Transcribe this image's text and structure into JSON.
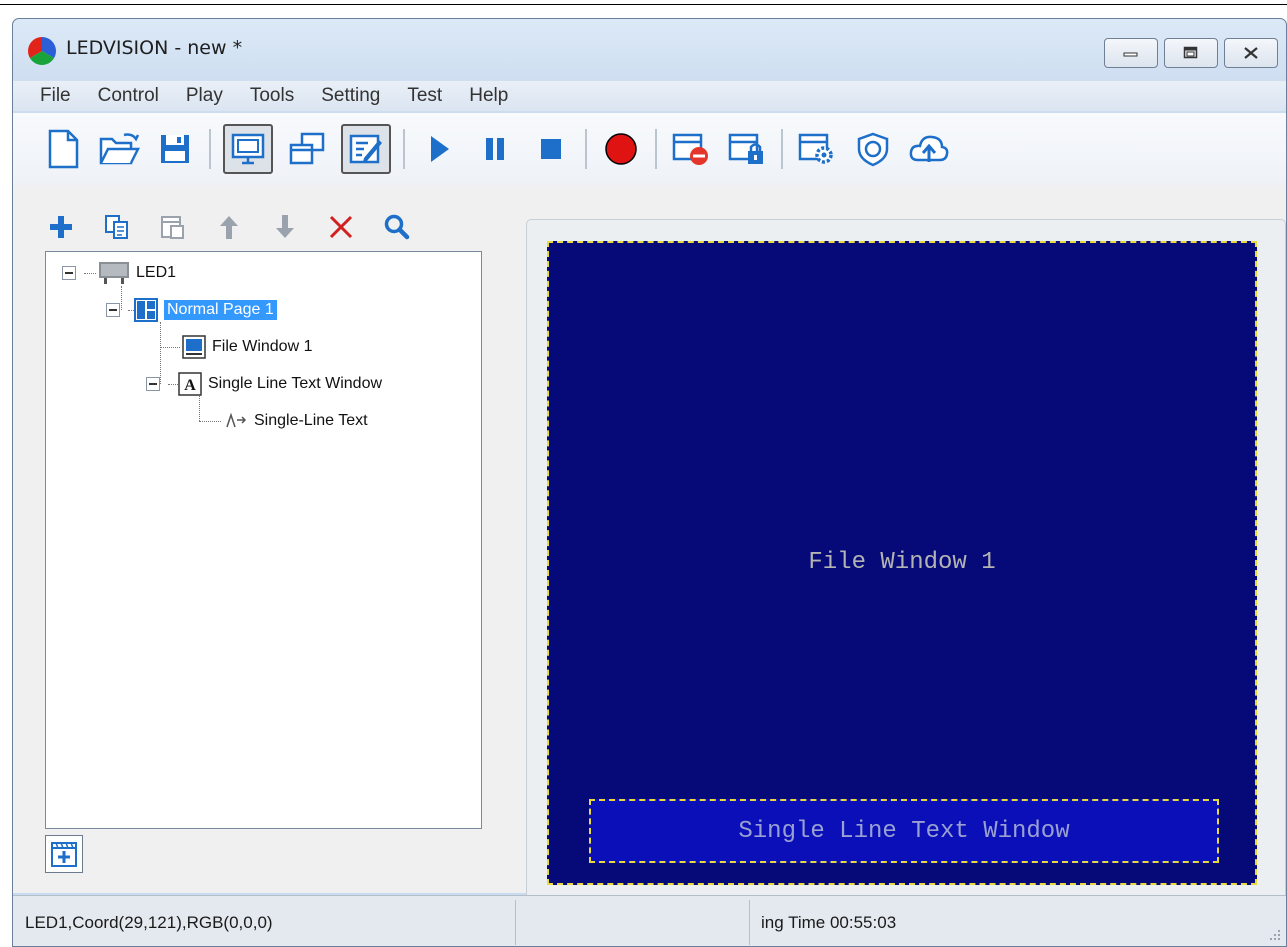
{
  "window": {
    "title": "LEDVISION - new *"
  },
  "menu": [
    "File",
    "Control",
    "Play",
    "Tools",
    "Setting",
    "Test",
    "Help"
  ],
  "toolbar": {
    "buttons": [
      "new-file",
      "open-file",
      "save-file",
      "screen-view",
      "window-view",
      "edit-mode",
      "play",
      "pause",
      "stop",
      "record",
      "clear-screen",
      "lock-screen",
      "screen-settings",
      "shield",
      "cloud-upload"
    ]
  },
  "left_toolbar": [
    "add",
    "copy",
    "paste",
    "move-up",
    "move-down",
    "delete",
    "search"
  ],
  "tree": {
    "led": "LED1",
    "page": "Normal Page 1",
    "file_window": "File Window 1",
    "text_window": "Single Line Text Window",
    "text_item": "Single-Line Text"
  },
  "preview": {
    "file_window_label": "File Window 1",
    "text_window_label": "Single Line Text Window"
  },
  "status": {
    "coord": "LED1,Coord(29,121),RGB(0,0,0)",
    "middle": "",
    "time": "ing Time 00:55:03"
  },
  "colors": {
    "led_background": "#050a78",
    "text_window_background": "#0a0fb8",
    "dash_border": "#e8d93c",
    "selection": "#3399ff"
  }
}
